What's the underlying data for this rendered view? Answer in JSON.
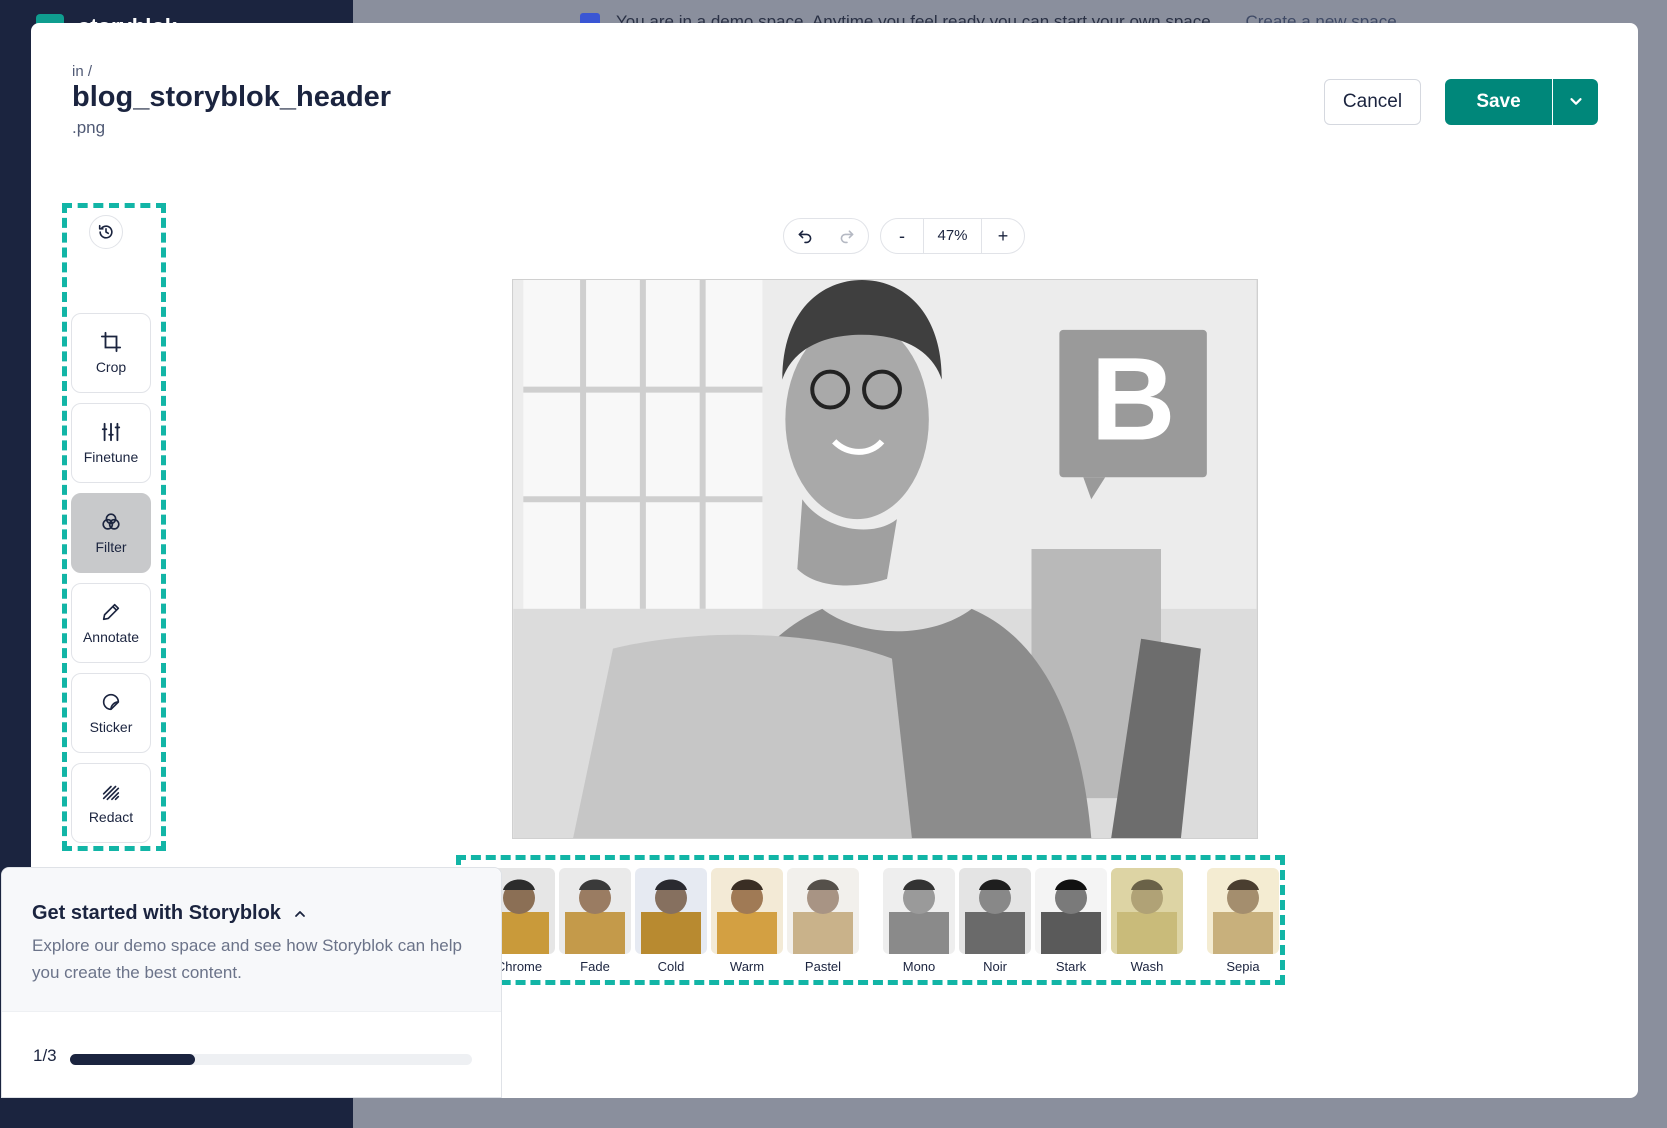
{
  "background": {
    "banner_text": "You are in a demo space. Anytime you feel ready you can start your own space.",
    "banner_link": "Create a new space",
    "brand_name": "storyblok"
  },
  "header": {
    "path": "in /",
    "filename": "blog_storyblok_header",
    "extension": ".png",
    "cancel_label": "Cancel",
    "save_label": "Save"
  },
  "tools": [
    {
      "label": "Crop",
      "icon": "crop-icon"
    },
    {
      "label": "Finetune",
      "icon": "sliders-icon"
    },
    {
      "label": "Filter",
      "icon": "filter-icon",
      "active": true
    },
    {
      "label": "Annotate",
      "icon": "pencil-icon"
    },
    {
      "label": "Sticker",
      "icon": "sticker-icon"
    },
    {
      "label": "Redact",
      "icon": "redact-icon"
    }
  ],
  "zoom": {
    "value": "47%",
    "minus": "-",
    "plus": "+"
  },
  "filters": [
    {
      "label": "Chrome",
      "tint": "#c99a3a"
    },
    {
      "label": "Fade",
      "tint": "#c49a4a"
    },
    {
      "label": "Cold",
      "tint": "#b88a30"
    },
    {
      "label": "Warm",
      "tint": "#d3a042"
    },
    {
      "label": "Pastel",
      "tint": "#c9b28a"
    },
    {
      "label": "Mono",
      "tint": "#8a8a8a"
    },
    {
      "label": "Noir",
      "tint": "#6a6a6a"
    },
    {
      "label": "Stark",
      "tint": "#5a5a5a"
    },
    {
      "label": "Wash",
      "tint": "#c9bb7a"
    },
    {
      "label": "Sepia",
      "tint": "#c8b07c"
    }
  ],
  "onboarding": {
    "title": "Get started with Storyblok",
    "description": "Explore our demo space and see how Storyblok can help you create the best content.",
    "step": "1/3",
    "progress": 0.31
  },
  "colors": {
    "accent": "#00877a",
    "highlight_dash": "#12b5a6",
    "ink": "#1b243f"
  }
}
